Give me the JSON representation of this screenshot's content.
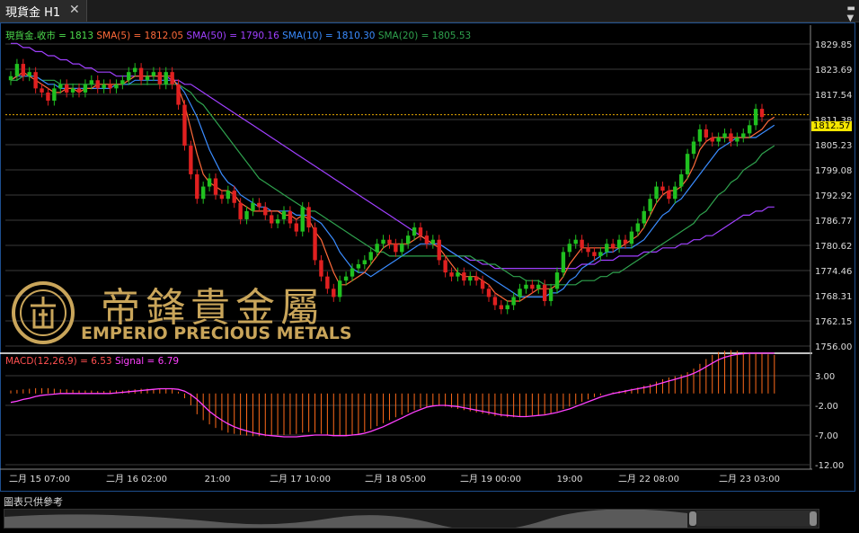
{
  "tab": {
    "title": "現貨金 H1",
    "close_icon": "close-icon",
    "menu_icon": "dropdown-menu-icon"
  },
  "legend": {
    "close": {
      "text": "現貨金.收市 = 1813",
      "color": "#4ddc4d"
    },
    "sma5": {
      "text": "SMA(5) = 1812.05",
      "color": "#ff6a3a"
    },
    "sma50": {
      "text": "SMA(50) = 1790.16",
      "color": "#a040ff"
    },
    "sma10": {
      "text": "SMA(10) = 1810.30",
      "color": "#3a8cff"
    },
    "sma20": {
      "text": "SMA(20) = 1805.53",
      "color": "#2fa24e"
    }
  },
  "macd_legend": {
    "macd": {
      "text": "MACD(12,26,9) = 6.53",
      "color": "#ff5050"
    },
    "signal": {
      "text": "Signal = 6.79",
      "color": "#ff40ff"
    }
  },
  "logo": {
    "cn": "帝鋒貴金屬",
    "en": "EMPERIO PRECIOUS METALS"
  },
  "footer_note": "圖表只供參考",
  "current_price_tag": "1812.57",
  "chart_data": [
    {
      "type": "candlestick",
      "ylim": [
        1753.5,
        1832
      ],
      "y_ticks": [
        "1829.85",
        "1823.69",
        "1817.54",
        "1811.38",
        "1805.23",
        "1799.08",
        "1792.92",
        "1786.77",
        "1780.62",
        "1774.46",
        "1768.31",
        "1762.15",
        "1756.00"
      ],
      "x_ticks": [
        "二月 15 07:00",
        "二月 16 02:00",
        "21:00",
        "二月 17 10:00",
        "二月 18 05:00",
        "二月 19 00:00",
        "19:00",
        "二月 22 08:00",
        "二月 23 03:00"
      ],
      "last_price": 1812.57,
      "candles": [
        [
          1821,
          1822
        ],
        [
          1822,
          1825
        ],
        [
          1825,
          1822
        ],
        [
          1822,
          1823
        ],
        [
          1823,
          1819
        ],
        [
          1819,
          1818
        ],
        [
          1818,
          1816
        ],
        [
          1816,
          1819
        ],
        [
          1819,
          1820
        ],
        [
          1820,
          1818
        ],
        [
          1818,
          1819
        ],
        [
          1819,
          1818
        ],
        [
          1818,
          1820
        ],
        [
          1820,
          1821
        ],
        [
          1821,
          1819
        ],
        [
          1819,
          1820
        ],
        [
          1820,
          1819
        ],
        [
          1819,
          1820
        ],
        [
          1820,
          1821
        ],
        [
          1821,
          1823
        ],
        [
          1823,
          1824
        ],
        [
          1824,
          1821
        ],
        [
          1821,
          1822
        ],
        [
          1822,
          1823
        ],
        [
          1823,
          1820
        ],
        [
          1820,
          1823
        ],
        [
          1823,
          1820
        ],
        [
          1820,
          1815
        ],
        [
          1815,
          1805
        ],
        [
          1805,
          1798
        ],
        [
          1798,
          1792
        ],
        [
          1792,
          1795
        ],
        [
          1795,
          1797
        ],
        [
          1797,
          1793
        ],
        [
          1793,
          1792
        ],
        [
          1792,
          1794
        ],
        [
          1794,
          1791
        ],
        [
          1791,
          1787
        ],
        [
          1787,
          1789
        ],
        [
          1789,
          1791
        ],
        [
          1791,
          1790
        ],
        [
          1790,
          1788
        ],
        [
          1788,
          1786
        ],
        [
          1786,
          1787
        ],
        [
          1787,
          1789
        ],
        [
          1789,
          1786
        ],
        [
          1786,
          1784
        ],
        [
          1784,
          1790
        ],
        [
          1790,
          1785
        ],
        [
          1785,
          1777
        ],
        [
          1777,
          1773
        ],
        [
          1773,
          1770
        ],
        [
          1770,
          1768
        ],
        [
          1768,
          1772
        ],
        [
          1772,
          1773
        ],
        [
          1773,
          1775
        ],
        [
          1775,
          1776
        ],
        [
          1776,
          1777
        ],
        [
          1777,
          1779
        ],
        [
          1779,
          1781
        ],
        [
          1781,
          1782
        ],
        [
          1782,
          1781
        ],
        [
          1781,
          1779
        ],
        [
          1779,
          1781
        ],
        [
          1781,
          1783
        ],
        [
          1783,
          1785
        ],
        [
          1785,
          1783
        ],
        [
          1783,
          1781
        ],
        [
          1781,
          1782
        ],
        [
          1782,
          1777
        ],
        [
          1777,
          1774
        ],
        [
          1774,
          1773
        ],
        [
          1773,
          1774
        ],
        [
          1774,
          1772
        ],
        [
          1772,
          1773
        ],
        [
          1773,
          1772
        ],
        [
          1772,
          1770
        ],
        [
          1770,
          1768
        ],
        [
          1768,
          1766
        ],
        [
          1766,
          1765
        ],
        [
          1765,
          1766
        ],
        [
          1766,
          1768
        ],
        [
          1768,
          1770
        ],
        [
          1770,
          1771
        ],
        [
          1771,
          1770
        ],
        [
          1770,
          1771
        ],
        [
          1771,
          1767
        ],
        [
          1767,
          1770
        ],
        [
          1770,
          1774
        ],
        [
          1774,
          1779
        ],
        [
          1779,
          1781
        ],
        [
          1781,
          1782
        ],
        [
          1782,
          1780
        ],
        [
          1780,
          1779
        ],
        [
          1779,
          1778
        ],
        [
          1778,
          1779
        ],
        [
          1779,
          1781
        ],
        [
          1781,
          1780
        ],
        [
          1780,
          1782
        ],
        [
          1782,
          1781
        ],
        [
          1781,
          1784
        ],
        [
          1784,
          1786
        ],
        [
          1786,
          1789
        ],
        [
          1789,
          1792
        ],
        [
          1792,
          1795
        ],
        [
          1795,
          1794
        ],
        [
          1794,
          1792
        ],
        [
          1792,
          1795
        ],
        [
          1795,
          1798
        ],
        [
          1798,
          1803
        ],
        [
          1803,
          1806
        ],
        [
          1806,
          1809
        ],
        [
          1809,
          1807
        ],
        [
          1807,
          1806
        ],
        [
          1806,
          1807
        ],
        [
          1807,
          1808
        ],
        [
          1808,
          1806
        ],
        [
          1806,
          1807
        ],
        [
          1807,
          1808
        ],
        [
          1808,
          1810
        ],
        [
          1810,
          1814
        ],
        [
          1814,
          1812
        ]
      ],
      "sma5": [
        1821,
        1822,
        1823,
        1822,
        1821,
        1820,
        1819,
        1818,
        1818,
        1819,
        1819,
        1818,
        1819,
        1819,
        1820,
        1820,
        1820,
        1820,
        1820,
        1821,
        1822,
        1822,
        1822,
        1822,
        1822,
        1822,
        1822,
        1819,
        1815,
        1809,
        1803,
        1798,
        1796,
        1795,
        1794,
        1794,
        1793,
        1791,
        1790,
        1789,
        1789,
        1789,
        1789,
        1789,
        1788,
        1788,
        1787,
        1788,
        1787,
        1784,
        1782,
        1778,
        1774,
        1771,
        1771,
        1772,
        1773,
        1774,
        1776,
        1778,
        1780,
        1781,
        1781,
        1781,
        1781,
        1782,
        1783,
        1782,
        1781,
        1780,
        1778,
        1776,
        1774,
        1773,
        1773,
        1773,
        1772,
        1771,
        1769,
        1768,
        1767,
        1767,
        1767,
        1768,
        1769,
        1770,
        1770,
        1770,
        1771,
        1773,
        1776,
        1778,
        1780,
        1780,
        1780,
        1780,
        1780,
        1780,
        1780,
        1781,
        1782,
        1783,
        1785,
        1788,
        1791,
        1793,
        1794,
        1794,
        1795,
        1797,
        1800,
        1804,
        1806,
        1807,
        1807,
        1807,
        1807,
        1807,
        1807,
        1807,
        1808,
        1809,
        1811,
        1812
      ],
      "sma10": [
        1821,
        1822,
        1822,
        1822,
        1822,
        1821,
        1820,
        1820,
        1819,
        1819,
        1819,
        1819,
        1819,
        1819,
        1819,
        1819,
        1819,
        1820,
        1820,
        1820,
        1821,
        1821,
        1821,
        1821,
        1821,
        1821,
        1821,
        1820,
        1818,
        1815,
        1812,
        1808,
        1804,
        1801,
        1798,
        1796,
        1795,
        1793,
        1792,
        1791,
        1790,
        1790,
        1789,
        1789,
        1789,
        1789,
        1788,
        1788,
        1788,
        1787,
        1786,
        1784,
        1782,
        1779,
        1777,
        1775,
        1774,
        1774,
        1773,
        1774,
        1775,
        1776,
        1777,
        1778,
        1779,
        1780,
        1781,
        1781,
        1781,
        1781,
        1780,
        1779,
        1778,
        1777,
        1776,
        1775,
        1774,
        1773,
        1772,
        1771,
        1770,
        1769,
        1768,
        1768,
        1768,
        1768,
        1768,
        1769,
        1769,
        1770,
        1772,
        1773,
        1775,
        1776,
        1777,
        1778,
        1779,
        1779,
        1780,
        1780,
        1780,
        1781,
        1782,
        1784,
        1786,
        1788,
        1789,
        1791,
        1792,
        1794,
        1796,
        1798,
        1800,
        1802,
        1804,
        1805,
        1806,
        1807,
        1807,
        1807,
        1807,
        1808,
        1809,
        1810
      ],
      "sma20": [
        1821,
        1821,
        1822,
        1822,
        1822,
        1821,
        1821,
        1821,
        1820,
        1820,
        1820,
        1820,
        1820,
        1820,
        1820,
        1820,
        1820,
        1820,
        1820,
        1820,
        1820,
        1820,
        1820,
        1820,
        1820,
        1820,
        1820,
        1820,
        1819,
        1818,
        1816,
        1815,
        1813,
        1811,
        1809,
        1807,
        1805,
        1803,
        1801,
        1799,
        1797,
        1796,
        1795,
        1794,
        1793,
        1792,
        1791,
        1790,
        1789,
        1789,
        1788,
        1787,
        1786,
        1785,
        1784,
        1783,
        1782,
        1781,
        1780,
        1779,
        1779,
        1778,
        1778,
        1778,
        1778,
        1778,
        1778,
        1778,
        1778,
        1778,
        1778,
        1778,
        1778,
        1778,
        1778,
        1777,
        1777,
        1776,
        1776,
        1775,
        1774,
        1773,
        1773,
        1772,
        1772,
        1772,
        1771,
        1771,
        1771,
        1771,
        1771,
        1771,
        1772,
        1772,
        1772,
        1773,
        1773,
        1774,
        1774,
        1775,
        1776,
        1777,
        1778,
        1779,
        1780,
        1781,
        1782,
        1783,
        1784,
        1785,
        1786,
        1788,
        1789,
        1791,
        1793,
        1794,
        1796,
        1797,
        1799,
        1800,
        1801,
        1803,
        1804,
        1805
      ],
      "sma50": [
        1830,
        1830,
        1829,
        1829,
        1828,
        1828,
        1827,
        1827,
        1826,
        1826,
        1825,
        1825,
        1824,
        1824,
        1823,
        1823,
        1823,
        1822,
        1822,
        1822,
        1822,
        1822,
        1822,
        1822,
        1822,
        1822,
        1821,
        1821,
        1820,
        1820,
        1819,
        1818,
        1817,
        1816,
        1815,
        1814,
        1813,
        1812,
        1811,
        1810,
        1809,
        1808,
        1807,
        1806,
        1805,
        1804,
        1803,
        1802,
        1801,
        1800,
        1799,
        1798,
        1797,
        1796,
        1795,
        1794,
        1793,
        1792,
        1791,
        1790,
        1789,
        1788,
        1787,
        1786,
        1785,
        1784,
        1783,
        1782,
        1781,
        1781,
        1780,
        1779,
        1778,
        1778,
        1777,
        1777,
        1776,
        1776,
        1775,
        1775,
        1775,
        1775,
        1775,
        1775,
        1775,
        1775,
        1775,
        1775,
        1775,
        1775,
        1775,
        1775,
        1776,
        1776,
        1776,
        1777,
        1777,
        1777,
        1778,
        1778,
        1778,
        1778,
        1779,
        1779,
        1779,
        1780,
        1780,
        1780,
        1781,
        1781,
        1782,
        1782,
        1783,
        1783,
        1784,
        1785,
        1786,
        1787,
        1788,
        1788,
        1789,
        1789,
        1790,
        1790
      ]
    },
    {
      "type": "macd",
      "ylim": [
        -12.5,
        9
      ],
      "y_ticks": [
        "3.00",
        "-2.00",
        "-7.00",
        "-12.00"
      ],
      "macd": 6.53,
      "signal": 6.79,
      "hist": [
        0.5,
        0.6,
        0.7,
        0.8,
        0.9,
        0.9,
        0.9,
        0.8,
        0.7,
        0.7,
        0.6,
        0.5,
        0.5,
        0.5,
        0.4,
        0.4,
        0.5,
        0.5,
        0.5,
        0.6,
        0.7,
        0.8,
        0.8,
        0.8,
        0.8,
        0.8,
        0.7,
        0.3,
        -0.8,
        -2,
        -3.5,
        -4.5,
        -5.2,
        -5.8,
        -6.2,
        -6.6,
        -6.8,
        -7,
        -7.1,
        -7.2,
        -7.2,
        -7.2,
        -7.1,
        -7,
        -7,
        -6.9,
        -6.8,
        -6.6,
        -6.5,
        -6.6,
        -6.8,
        -7,
        -7.2,
        -7.2,
        -7.1,
        -7,
        -6.8,
        -6.5,
        -6,
        -5.5,
        -5,
        -4.5,
        -4,
        -3.6,
        -3.2,
        -2.8,
        -2.5,
        -2.3,
        -2.1,
        -2.1,
        -2.2,
        -2.4,
        -2.6,
        -2.8,
        -3,
        -3.2,
        -3.4,
        -3.6,
        -3.8,
        -3.9,
        -4,
        -4,
        -3.9,
        -3.8,
        -3.7,
        -3.6,
        -3.5,
        -3.3,
        -3,
        -2.6,
        -2.2,
        -1.8,
        -1.4,
        -1,
        -0.6,
        -0.3,
        0,
        0.2,
        0.4,
        0.6,
        0.8,
        1,
        1.3,
        1.6,
        2,
        2.4,
        2.7,
        2.9,
        3.2,
        3.6,
        4.2,
        5,
        5.8,
        6.5,
        7,
        7.2,
        7.3,
        7.2,
        7,
        6.9,
        6.8,
        6.7,
        6.6,
        6.5
      ],
      "signal_line": [
        -1.5,
        -1.3,
        -1,
        -0.8,
        -0.5,
        -0.3,
        -0.2,
        -0.1,
        0,
        0,
        0,
        0,
        0,
        0,
        0,
        0,
        0,
        0.1,
        0.2,
        0.3,
        0.4,
        0.5,
        0.6,
        0.7,
        0.8,
        0.8,
        0.8,
        0.7,
        0.4,
        -0.2,
        -1,
        -2,
        -3,
        -3.8,
        -4.5,
        -5.1,
        -5.6,
        -6,
        -6.3,
        -6.6,
        -6.8,
        -7,
        -7.1,
        -7.2,
        -7.3,
        -7.3,
        -7.3,
        -7.2,
        -7.1,
        -7,
        -7,
        -7,
        -7.1,
        -7.1,
        -7.1,
        -7,
        -6.9,
        -6.7,
        -6.4,
        -6,
        -5.6,
        -5.1,
        -4.6,
        -4.1,
        -3.6,
        -3.1,
        -2.7,
        -2.3,
        -2.1,
        -2,
        -2,
        -2.1,
        -2.2,
        -2.4,
        -2.6,
        -2.8,
        -3,
        -3.2,
        -3.4,
        -3.6,
        -3.7,
        -3.8,
        -3.9,
        -3.9,
        -3.8,
        -3.7,
        -3.6,
        -3.4,
        -3.2,
        -2.9,
        -2.6,
        -2.2,
        -1.8,
        -1.4,
        -1,
        -0.6,
        -0.3,
        0,
        0.2,
        0.4,
        0.6,
        0.8,
        1,
        1.2,
        1.5,
        1.8,
        2.1,
        2.4,
        2.7,
        3,
        3.4,
        3.9,
        4.5,
        5.1,
        5.7,
        6.1,
        6.4,
        6.6,
        6.7,
        6.8,
        6.8,
        6.8,
        6.8,
        6.8
      ]
    }
  ]
}
